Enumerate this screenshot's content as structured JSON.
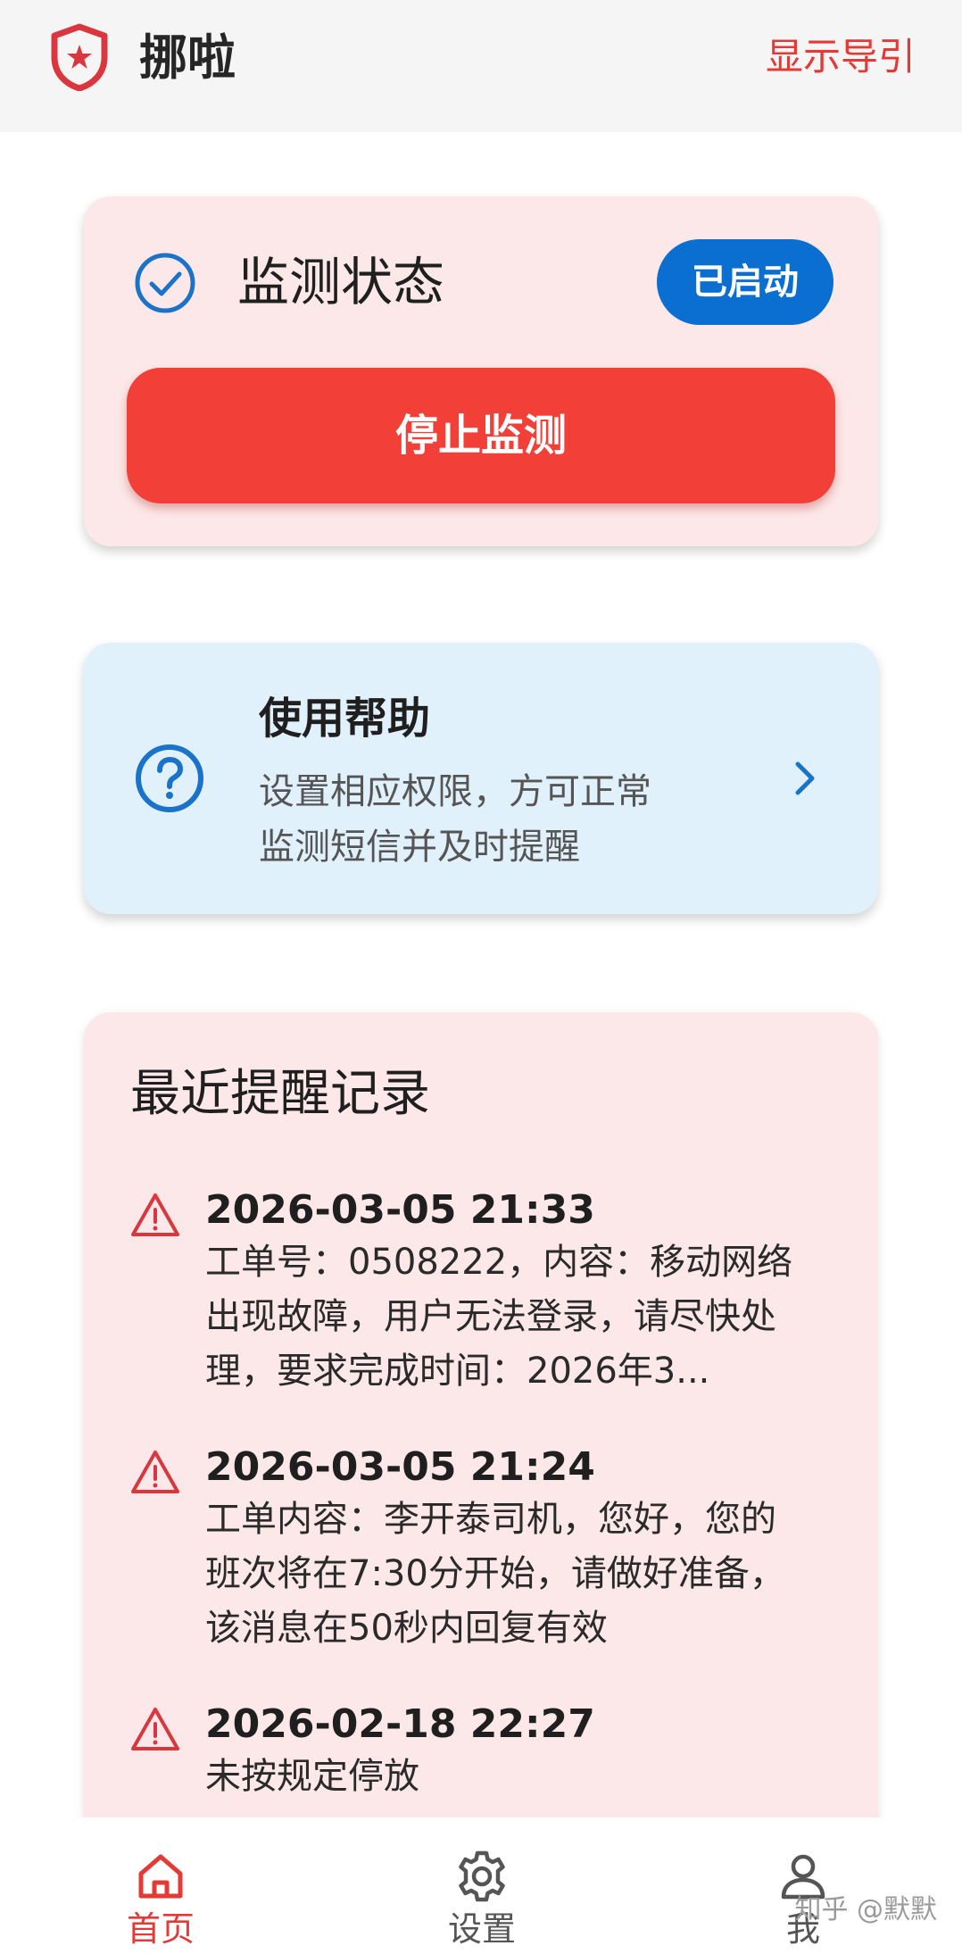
{
  "app": {
    "title": "挪啦",
    "guide_link": "显示导引"
  },
  "status_card": {
    "title": "监测状态",
    "badge": "已启动",
    "stop_button": "停止监测"
  },
  "help_card": {
    "title": "使用帮助",
    "desc_line1": "设置相应权限，方可正常",
    "desc_line2": "监测短信并及时提醒"
  },
  "records": {
    "title": "最近提醒记录",
    "items": [
      {
        "time": "2026-03-05 21:33",
        "lines": [
          "工单号：0508222，内容：移动网络",
          "出现故障，用户无法登录，请尽快处",
          "理，要求完成时间：2026年3..."
        ]
      },
      {
        "time": "2026-03-05 21:24",
        "lines": [
          "工单内容：李开泰司机，您好，您的",
          "班次将在7:30分开始，请做好准备，",
          "该消息在50秒内回复有效"
        ]
      },
      {
        "time": "2026-02-18 22:27",
        "lines": [
          "未按规定停放"
        ]
      }
    ]
  },
  "nav": {
    "home": "首页",
    "settings": "设置",
    "me": "我"
  },
  "watermark": "知乎 @默默",
  "colors": {
    "accent_red": "#e53935",
    "stop_button": "#f24039",
    "badge_blue": "#0a6fd1",
    "status_card_bg": "#fce8e8",
    "help_card_bg": "#e1f1fc"
  },
  "icons": {
    "logo": "shield-star-icon",
    "check": "check-circle-icon",
    "help": "question-circle-icon",
    "chevron": "chevron-right-icon",
    "warning": "warning-triangle-icon",
    "home": "home-icon",
    "settings": "gear-icon",
    "me": "person-icon"
  }
}
